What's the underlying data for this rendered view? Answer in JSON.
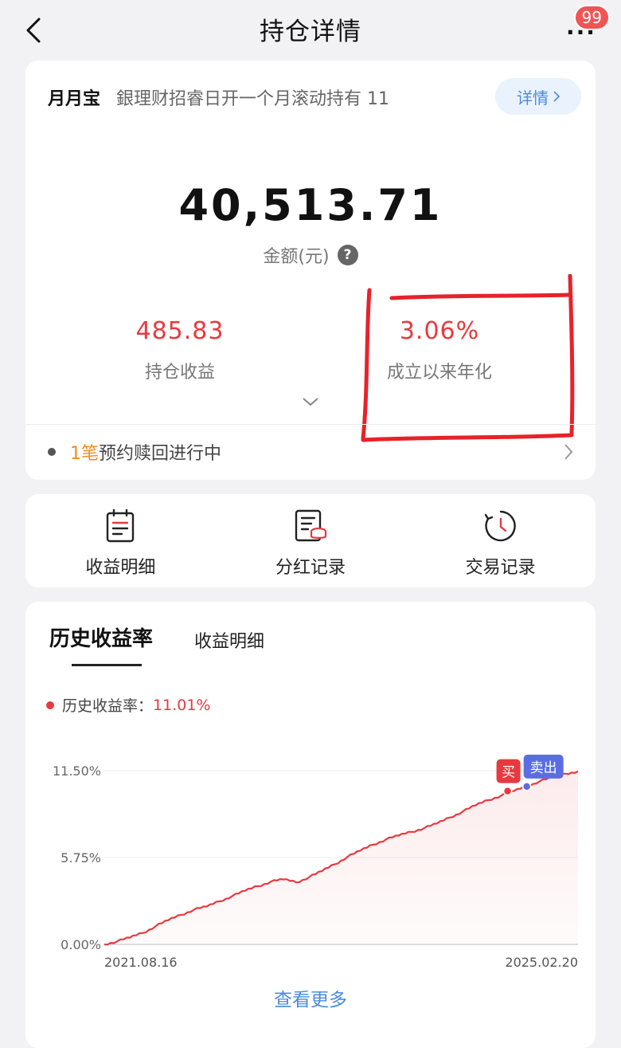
{
  "header": {
    "title": "持仓详情",
    "more_label": "···",
    "badge_count": "99"
  },
  "holding": {
    "product_name": "月月宝",
    "product_desc": "銀理财招睿日开一个月滚动持有 11",
    "detail_label": "详情",
    "amount_value": "40,513.71",
    "amount_label": "金额(元)",
    "profit_value": "485.83",
    "profit_label": "持仓收益",
    "annual_value": "3.06%",
    "annual_label": "成立以来年化",
    "notice_count": "1笔",
    "notice_text": "预约赎回进行中"
  },
  "shortcuts": [
    {
      "label": "收益明细",
      "icon": "clipboard-list-icon"
    },
    {
      "label": "分红记录",
      "icon": "document-coins-icon"
    },
    {
      "label": "交易记录",
      "icon": "clock-history-icon"
    }
  ],
  "history": {
    "tab_active": "历史收益率",
    "tab_inactive": "收益明细",
    "legend_label": "历史收益率：",
    "legend_value": "11.01%",
    "view_more": "查看更多"
  },
  "colors": {
    "accent_red": "#e8393f",
    "accent_blue": "#4a8bdc",
    "buy_marker": "#e8393f",
    "sell_marker": "#5b6ee1"
  },
  "chart_data": {
    "type": "area",
    "x_start_label": "2021.08.16",
    "x_end_label": "2025.02.20",
    "y_ticks": [
      "11.50%",
      "5.75%",
      "0.00%"
    ],
    "ylim": [
      0,
      11.5
    ],
    "grid": true,
    "values": [
      0.0,
      0.2,
      0.45,
      0.75,
      1.2,
      1.6,
      1.95,
      2.3,
      2.5,
      2.85,
      3.2,
      3.55,
      3.85,
      4.15,
      4.3,
      4.1,
      4.45,
      4.85,
      5.3,
      5.8,
      6.2,
      6.6,
      6.95,
      7.2,
      7.45,
      7.7,
      8.0,
      8.4,
      8.8,
      9.2,
      9.55,
      9.85,
      10.15,
      10.45,
      10.8,
      11.05,
      11.3,
      11.45
    ],
    "markers": [
      {
        "label": "买",
        "index": 32
      },
      {
        "label": "卖出",
        "index": 33
      }
    ]
  }
}
